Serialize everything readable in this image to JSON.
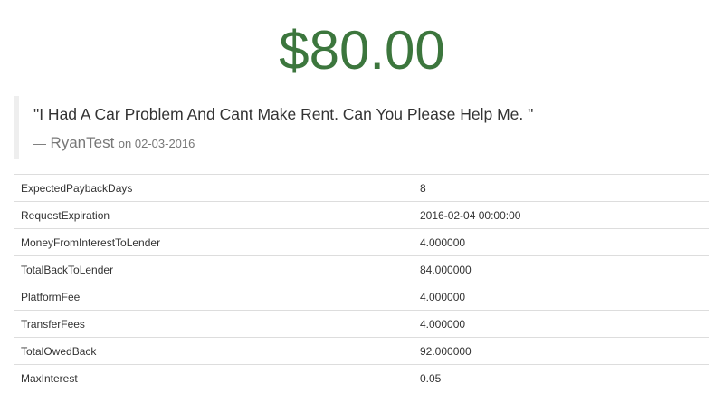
{
  "loan": {
    "amount": "$80.00"
  },
  "quote": {
    "text": "\"I Had A Car Problem And Cant Make Rent. Can You Please Help Me. \"",
    "dash": "—",
    "author": "RyanTest",
    "date_prefix": "on",
    "date": "02-03-2016"
  },
  "details": [
    {
      "label": "ExpectedPaybackDays",
      "value": "8"
    },
    {
      "label": "RequestExpiration",
      "value": "2016-02-04 00:00:00"
    },
    {
      "label": "MoneyFromInterestToLender",
      "value": "4.000000"
    },
    {
      "label": "TotalBackToLender",
      "value": "84.000000"
    },
    {
      "label": "PlatformFee",
      "value": "4.000000"
    },
    {
      "label": "TransferFees",
      "value": "4.000000"
    },
    {
      "label": "TotalOwedBack",
      "value": "92.000000"
    },
    {
      "label": "MaxInterest",
      "value": "0.05"
    }
  ],
  "colors": {
    "amount": "#3c763d",
    "muted": "#777777",
    "border": "#dddddd"
  }
}
